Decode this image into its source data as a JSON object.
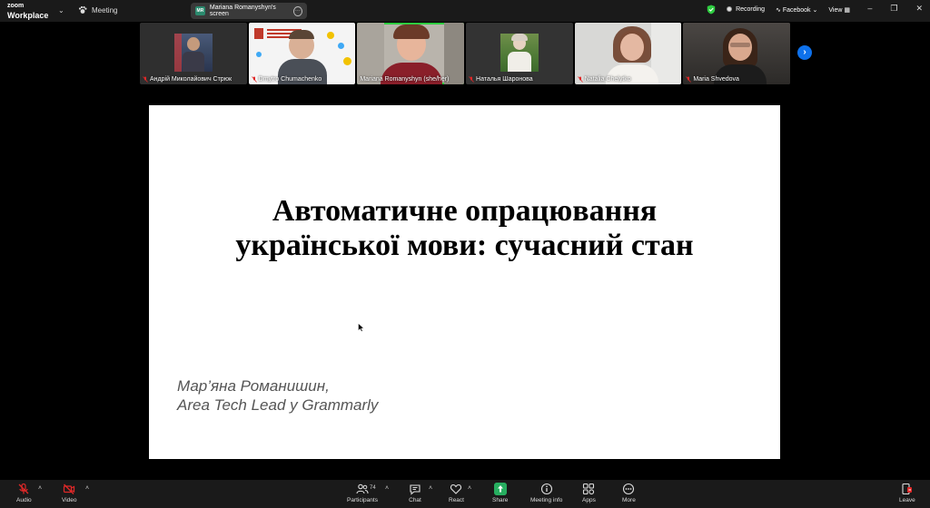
{
  "topbar": {
    "brand_top": "zoom",
    "brand_bottom": "Workplace",
    "meeting_label": "Meeting",
    "share_initials": "MR",
    "share_label": "Mariana Romanyshyn's screen",
    "recording_label": "Recording",
    "facebook_label": "Facebook",
    "view_label": "View"
  },
  "participants": [
    {
      "name": "Андрій Миколайович Стрюк"
    },
    {
      "name": "Dmytro Chumachenko"
    },
    {
      "name": "Mariana Romanyshyn (she/her)"
    },
    {
      "name": "Наталья Шаронова"
    },
    {
      "name": "Natalia Chelytko"
    },
    {
      "name": "Maria Shvedova"
    }
  ],
  "slide": {
    "title_line1": "Автоматичне опрацювання",
    "title_line2": "української мови: сучасний стан",
    "author_line1": "Мар’яна Романишин,",
    "author_line2": "Area Tech Lead у Grammarly"
  },
  "toolbar": {
    "audio": "Audio",
    "video": "Video",
    "participants": "Participants",
    "participants_count": "74",
    "chat": "Chat",
    "react": "React",
    "share": "Share",
    "meeting_info": "Meeting info",
    "apps": "Apps",
    "more": "More",
    "leave": "Leave"
  },
  "colors": {
    "accent_blue": "#0e71eb",
    "active_speaker": "#2ecc40",
    "share_green": "#27ae60",
    "mute_red": "#e02828"
  },
  "icons": [
    "paw-icon",
    "shield-icon",
    "mic-off-icon",
    "video-off-icon",
    "participants-icon",
    "chat-icon",
    "react-icon",
    "share-icon",
    "info-icon",
    "apps-icon",
    "more-icon",
    "leave-icon"
  ]
}
